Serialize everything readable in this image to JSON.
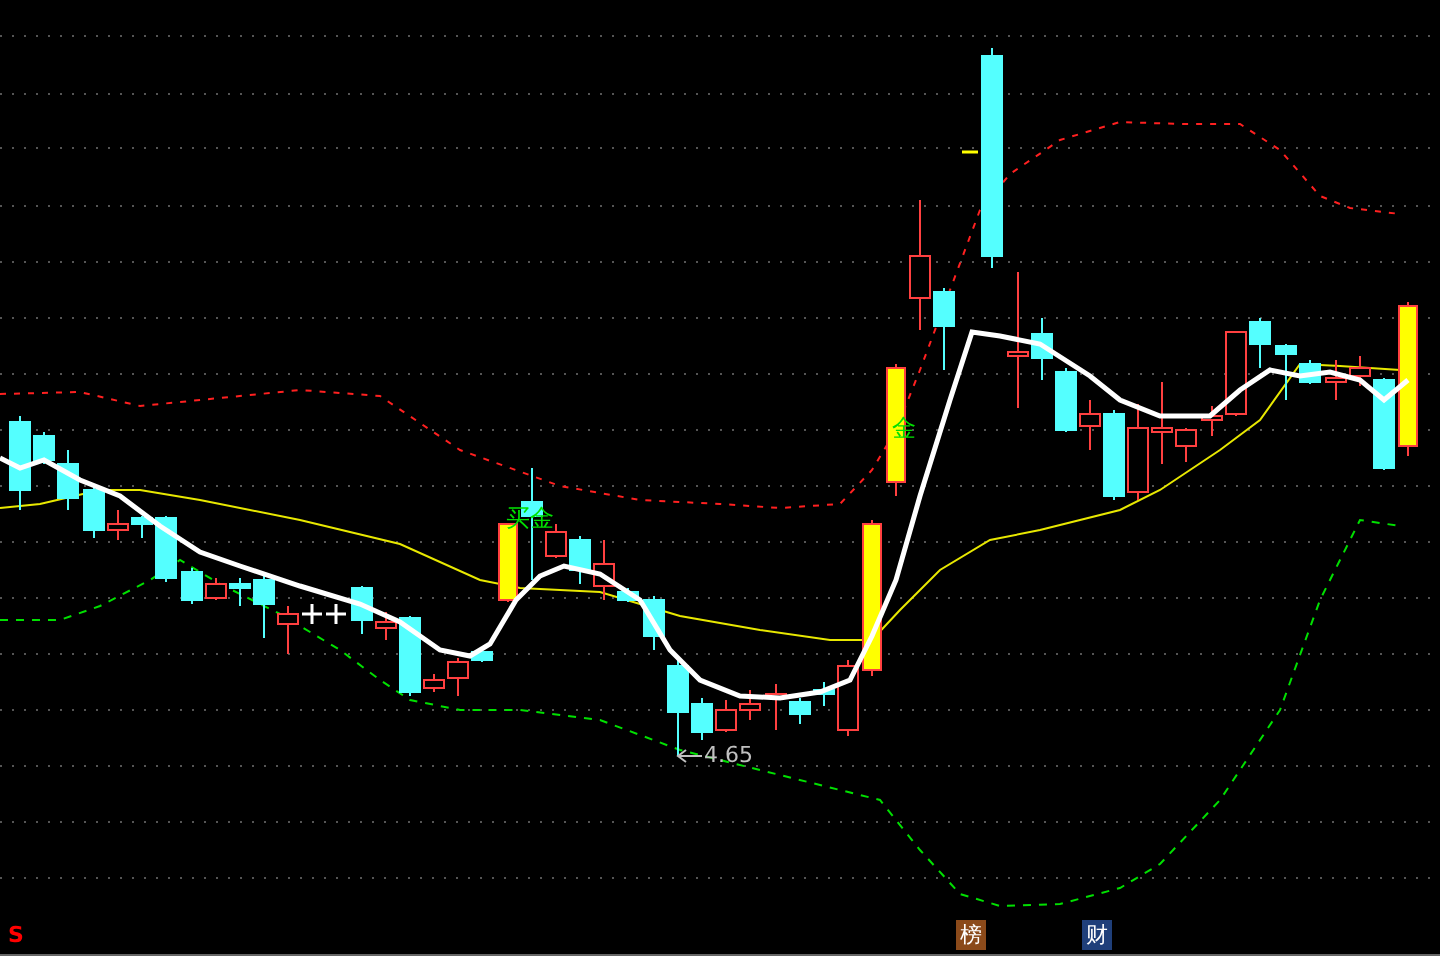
{
  "chart": {
    "signals": [
      {
        "text": "买金"
      },
      {
        "text": "金"
      }
    ],
    "low_marker": "4.65"
  },
  "bottom_bar": {
    "items": [
      {
        "text": "S",
        "kind": "signal",
        "color": "#ff0000"
      },
      {
        "text": "榜",
        "kind": "tab",
        "color": "#8b4a1a"
      },
      {
        "text": "财",
        "kind": "tab",
        "color": "#1f3f7a"
      }
    ]
  }
}
